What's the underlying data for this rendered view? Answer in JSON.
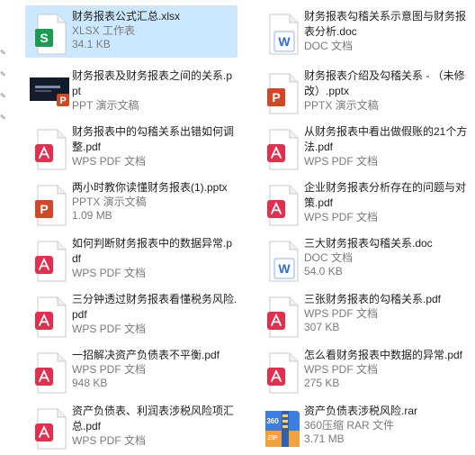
{
  "files": [
    {
      "name": "财务报表公式汇总.xlsx",
      "type": "XLSX 工作表",
      "size": "34.1 KB",
      "icon": "xlsx-icon",
      "selected": true
    },
    {
      "name": "财务报表勾稽关系示意图与财务报表分析.doc",
      "type": "DOC 文档",
      "size": "",
      "icon": "doc-icon"
    },
    {
      "name": "财务报表及财务报表之间的关系.ppt",
      "type": "PPT 演示文稿",
      "size": "",
      "icon": "ppt-thumbnail"
    },
    {
      "name": "财务报表介绍及勾稽关系 - （未修改）.pptx",
      "type": "PPTX 演示文稿",
      "size": "",
      "icon": "pptx-icon"
    },
    {
      "name": "财务报表中的勾稽关系出错如何调整.pdf",
      "type": "WPS PDF 文档",
      "size": "",
      "icon": "pdf-icon"
    },
    {
      "name": "从财务报表中看出做假账的21个方法.pdf",
      "type": "WPS PDF 文档",
      "size": "",
      "icon": "pdf-icon"
    },
    {
      "name": "两小时教你读懂财务报表(1).pptx",
      "type": "PPTX 演示文稿",
      "size": "1.09 MB",
      "icon": "pptx-icon"
    },
    {
      "name": "企业财务报表分析存在的问题与对策.pdf",
      "type": "WPS PDF 文档",
      "size": "",
      "icon": "pdf-icon"
    },
    {
      "name": "如何判断财务报表中的数据异常.pdf",
      "type": "WPS PDF 文档",
      "size": "",
      "icon": "pdf-icon"
    },
    {
      "name": "三大财务报表勾稽关系.doc",
      "type": "DOC 文档",
      "size": "54.0 KB",
      "icon": "doc-icon"
    },
    {
      "name": "三分钟透过财务报表看懂税务风险.pdf",
      "type": "WPS PDF 文档",
      "size": "",
      "icon": "pdf-icon"
    },
    {
      "name": "三张财务报表的勾稽关系.pdf",
      "type": "WPS PDF 文档",
      "size": "307 KB",
      "icon": "pdf-icon"
    },
    {
      "name": "一招解决资产负债表不平衡.pdf",
      "type": "WPS PDF 文档",
      "size": "948 KB",
      "icon": "pdf-icon"
    },
    {
      "name": "怎么看财务报表中数据的异常.pdf",
      "type": "WPS PDF 文档",
      "size": "275 KB",
      "icon": "pdf-icon"
    },
    {
      "name": "资产负债表、利润表涉税风险项汇总.pdf",
      "type": "WPS PDF 文档",
      "size": "",
      "icon": "pdf-icon"
    },
    {
      "name": "资产负债表涉税风险.rar",
      "type": "360压缩 RAR 文件",
      "size": "3.71 MB",
      "icon": "rar-360-icon"
    }
  ],
  "colors": {
    "selection": "#cce8ff",
    "xlsx": "#1e9b52",
    "doc": "#2f6fd1",
    "pptx": "#d24726",
    "pdf": "#e0304e"
  }
}
